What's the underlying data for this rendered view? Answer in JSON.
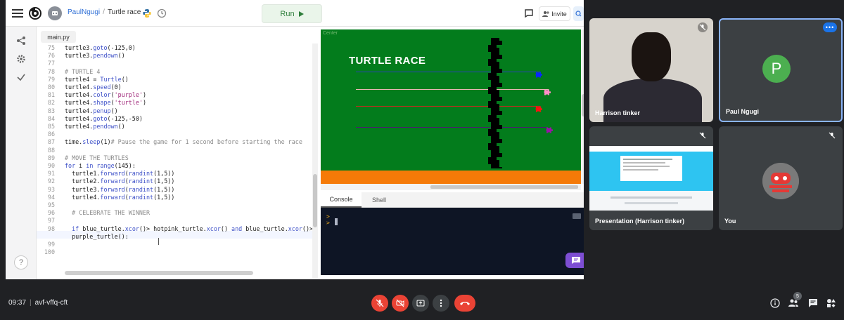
{
  "replit": {
    "user": "PaulNgugi",
    "separator": "/",
    "project": "Turtle race",
    "run_label": "Run",
    "invite_label": "Invite",
    "file_tab": "main.py",
    "help_label": "?",
    "console_tab": "Console",
    "shell_tab": "Shell",
    "console_prompt": ">\n>",
    "canvas_label": "Center",
    "race_title": "TURTLE RACE",
    "accent_green": "#037c1c",
    "track_orange": "#f57a08",
    "lane_colors": [
      "#2c3fbf",
      "#e8b7b7",
      "#c02a1e",
      "#4a1f6e"
    ],
    "turtle_colors": [
      "#0a26ff",
      "#ff8ec8",
      "#ff1010",
      "#9a12a8"
    ]
  },
  "code_lines": [
    {
      "n": "75",
      "t": "turtle3.goto(-125,0)"
    },
    {
      "n": "76",
      "t": "turtle3.pendown()"
    },
    {
      "n": "77",
      "t": ""
    },
    {
      "n": "78",
      "t": "# TURTLE 4"
    },
    {
      "n": "79",
      "t": "turtle4 = Turtle()"
    },
    {
      "n": "80",
      "t": "turtle4.speed(0)"
    },
    {
      "n": "81",
      "t": "turtle4.color('purple')"
    },
    {
      "n": "82",
      "t": "turtle4.shape('turtle')"
    },
    {
      "n": "83",
      "t": "turtle4.penup()"
    },
    {
      "n": "84",
      "t": "turtle4.goto(-125,-50)"
    },
    {
      "n": "85",
      "t": "turtle4.pendown()"
    },
    {
      "n": "86",
      "t": ""
    },
    {
      "n": "87",
      "t": "time.sleep(1)# Pause the game for 1 second before starting the race"
    },
    {
      "n": "88",
      "t": ""
    },
    {
      "n": "89",
      "t": "# MOVE THE TURTLES"
    },
    {
      "n": "90",
      "t": "for i in range(145):"
    },
    {
      "n": "91",
      "t": "  turtle1.forward(randint(1,5))"
    },
    {
      "n": "92",
      "t": "  turtle2.forward(randint(1,5))"
    },
    {
      "n": "93",
      "t": "  turtle3.forward(randint(1,5))"
    },
    {
      "n": "94",
      "t": "  turtle4.forward(randint(1,5))"
    },
    {
      "n": "95",
      "t": ""
    },
    {
      "n": "96",
      "t": "  # CELEBRATE THE WINNER"
    },
    {
      "n": "97",
      "t": ""
    },
    {
      "n": "98",
      "t": "  if blue_turtle.xcor()> hotpink_turtle.xcor() and blue_turtle.xcor()>"
    },
    {
      "n": "",
      "t": "  purple_turtle():"
    },
    {
      "n": "99",
      "t": ""
    },
    {
      "n": "100",
      "t": ""
    }
  ],
  "meet": {
    "tiles": {
      "harrison": "Harrison tinker",
      "paul": "Paul Ngugi",
      "presentation": "Presentation (Harrison tinker)",
      "you": "You"
    },
    "paul_initial": "P",
    "paul_avatar_color": "#4caf50",
    "time": "09:37",
    "meeting_code": "avf-vffq-cft",
    "participant_count": "5",
    "mute_color": "#ea4335"
  }
}
